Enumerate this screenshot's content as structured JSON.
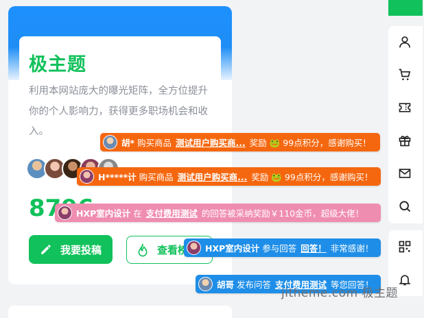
{
  "card": {
    "title": "极主题",
    "description": "利用本网站庞大的曝光矩阵，全方位提升你的个人影响力，获得更多职场机会和收入。",
    "count": "8796",
    "submit_label": "我要投稿",
    "rank_label": "查看榜"
  },
  "sidebar": {
    "icons": [
      "user-icon",
      "cart-icon",
      "ticket-icon",
      "gift-icon",
      "mail-icon",
      "search-icon",
      "qrcode-icon",
      "bell-icon"
    ]
  },
  "notifications": [
    {
      "user": "胡*",
      "action": "购买商品",
      "link": "测试用户购买商...",
      "reward": "奖励 🐸 99点积分，感谢购买！"
    },
    {
      "user": "H*****计",
      "action": "购买商品",
      "link": "测试用户购买商...",
      "reward": "奖励 🐸 99点积分，感谢购买！"
    },
    {
      "user": "HXP室内设计",
      "action": "在",
      "link": "支付费用测试",
      "reward": "的回答被采纳奖励￥110金币，超级大佬！"
    },
    {
      "user": "HXP室内设计",
      "action": "参与回答",
      "link": "回答！",
      "reward": "非常感谢！"
    },
    {
      "user": "胡哥",
      "action": "发布问答",
      "link": "支付费用测试",
      "reward": "等您回答！"
    }
  ],
  "watermark": "jitheme.com 极主题",
  "colors": {
    "accent": "#11c15b",
    "orange": "#f5670f",
    "pink": "#ef8db0",
    "blue": "#1e8ee8",
    "header": "#1e90ff"
  }
}
